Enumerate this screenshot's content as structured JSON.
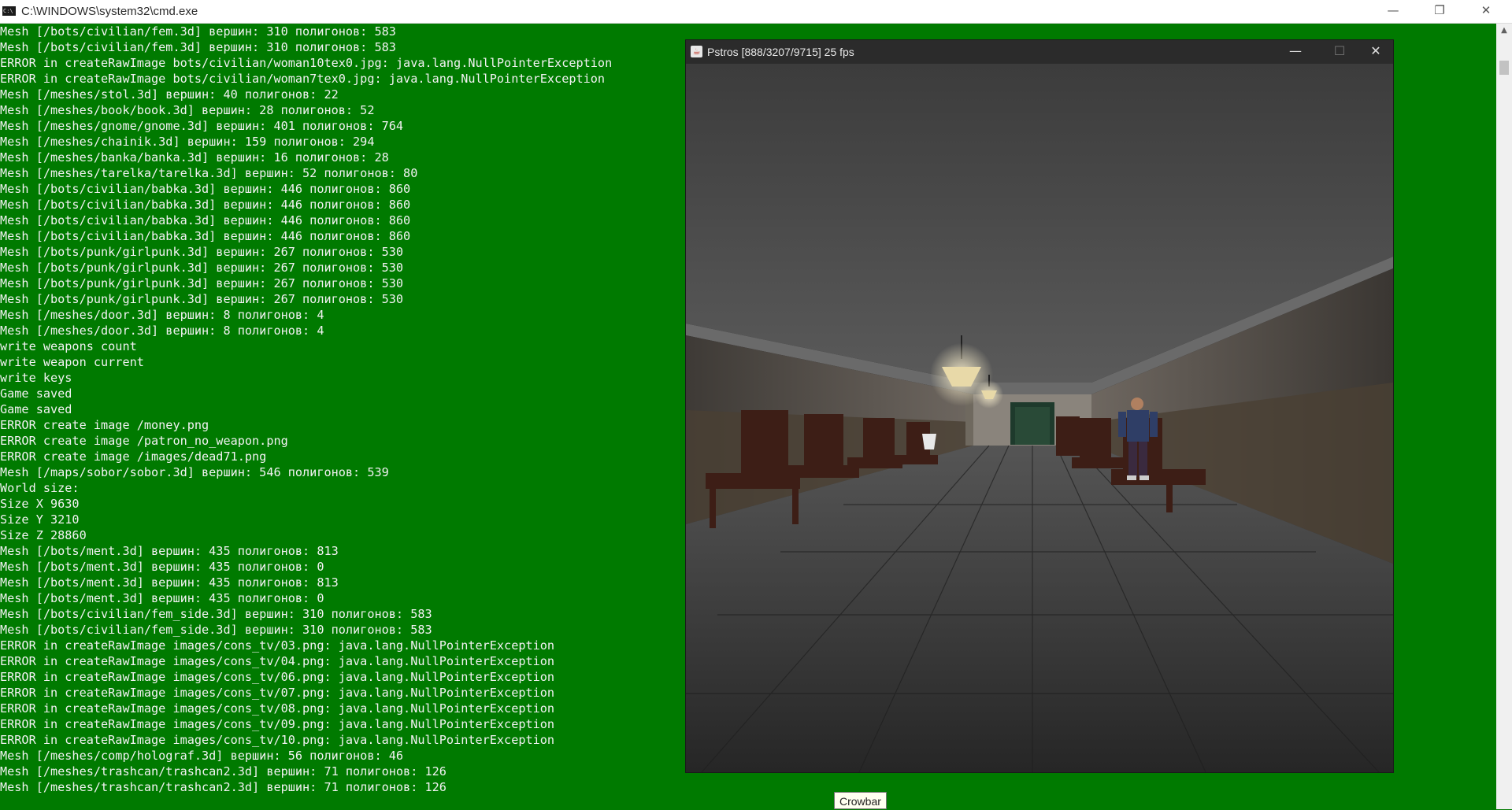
{
  "cmd_window": {
    "title": "C:\\WINDOWS\\system32\\cmd.exe",
    "icon": "console-icon",
    "icon_text": "C:\\",
    "minimize_symbol": "—",
    "restore_symbol": "❐",
    "close_symbol": "✕"
  },
  "console": {
    "text_color": "#f2f2f2",
    "background": "#007a00",
    "lines": [
      "Mesh [/bots/civilian/fem.3d] вершин: 310 полигонов: 583",
      "Mesh [/bots/civilian/fem.3d] вершин: 310 полигонов: 583",
      "ERROR in createRawImage bots/civilian/woman10tex0.jpg: java.lang.NullPointerException",
      "ERROR in createRawImage bots/civilian/woman7tex0.jpg: java.lang.NullPointerException",
      "Mesh [/meshes/stol.3d] вершин: 40 полигонов: 22",
      "Mesh [/meshes/book/book.3d] вершин: 28 полигонов: 52",
      "Mesh [/meshes/gnome/gnome.3d] вершин: 401 полигонов: 764",
      "Mesh [/meshes/chainik.3d] вершин: 159 полигонов: 294",
      "Mesh [/meshes/banka/banka.3d] вершин: 16 полигонов: 28",
      "Mesh [/meshes/tarelka/tarelka.3d] вершин: 52 полигонов: 80",
      "Mesh [/bots/civilian/babka.3d] вершин: 446 полигонов: 860",
      "Mesh [/bots/civilian/babka.3d] вершин: 446 полигонов: 860",
      "Mesh [/bots/civilian/babka.3d] вершин: 446 полигонов: 860",
      "Mesh [/bots/civilian/babka.3d] вершин: 446 полигонов: 860",
      "Mesh [/bots/punk/girlpunk.3d] вершин: 267 полигонов: 530",
      "Mesh [/bots/punk/girlpunk.3d] вершин: 267 полигонов: 530",
      "Mesh [/bots/punk/girlpunk.3d] вершин: 267 полигонов: 530",
      "Mesh [/bots/punk/girlpunk.3d] вершин: 267 полигонов: 530",
      "Mesh [/meshes/door.3d] вершин: 8 полигонов: 4",
      "Mesh [/meshes/door.3d] вершин: 8 полигонов: 4",
      "write weapons count",
      "write weapon current",
      "write keys",
      "Game saved",
      "Game saved",
      "ERROR create image /money.png",
      "ERROR create image /patron_no_weapon.png",
      "ERROR create image /images/dead71.png",
      "Mesh [/maps/sobor/sobor.3d] вершин: 546 полигонов: 539",
      "World size:",
      "Size X 9630",
      "Size Y 3210",
      "Size Z 28860",
      "Mesh [/bots/ment.3d] вершин: 435 полигонов: 813",
      "Mesh [/bots/ment.3d] вершин: 435 полигонов: 0",
      "Mesh [/bots/ment.3d] вершин: 435 полигонов: 813",
      "Mesh [/bots/ment.3d] вершин: 435 полигонов: 0",
      "Mesh [/bots/civilian/fem_side.3d] вершин: 310 полигонов: 583",
      "Mesh [/bots/civilian/fem_side.3d] вершин: 310 полигонов: 583",
      "ERROR in createRawImage images/cons_tv/03.png: java.lang.NullPointerException",
      "ERROR in createRawImage images/cons_tv/04.png: java.lang.NullPointerException",
      "ERROR in createRawImage images/cons_tv/06.png: java.lang.NullPointerException",
      "ERROR in createRawImage images/cons_tv/07.png: java.lang.NullPointerException",
      "ERROR in createRawImage images/cons_tv/08.png: java.lang.NullPointerException",
      "ERROR in createRawImage images/cons_tv/09.png: java.lang.NullPointerException",
      "ERROR in createRawImage images/cons_tv/10.png: java.lang.NullPointerException",
      "Mesh [/meshes/comp/holograf.3d] вершин: 56 полигонов: 46",
      "Mesh [/meshes/trashcan/trashcan2.3d] вершин: 71 полигонов: 126",
      "Mesh [/meshes/trashcan/trashcan2.3d] вершин: 71 полигонов: 126"
    ]
  },
  "game_window": {
    "title": "Pstros [888/3207/9715] 25 fps",
    "icon": "java-icon",
    "icon_text": "☕",
    "minimize_symbol": "—",
    "maximize_symbol": "☐",
    "close_symbol": "✕",
    "scene": "3d-corridor-view"
  },
  "tooltip": {
    "text": "Crowbar"
  },
  "scrollbar": {
    "up_arrow": "▲"
  }
}
